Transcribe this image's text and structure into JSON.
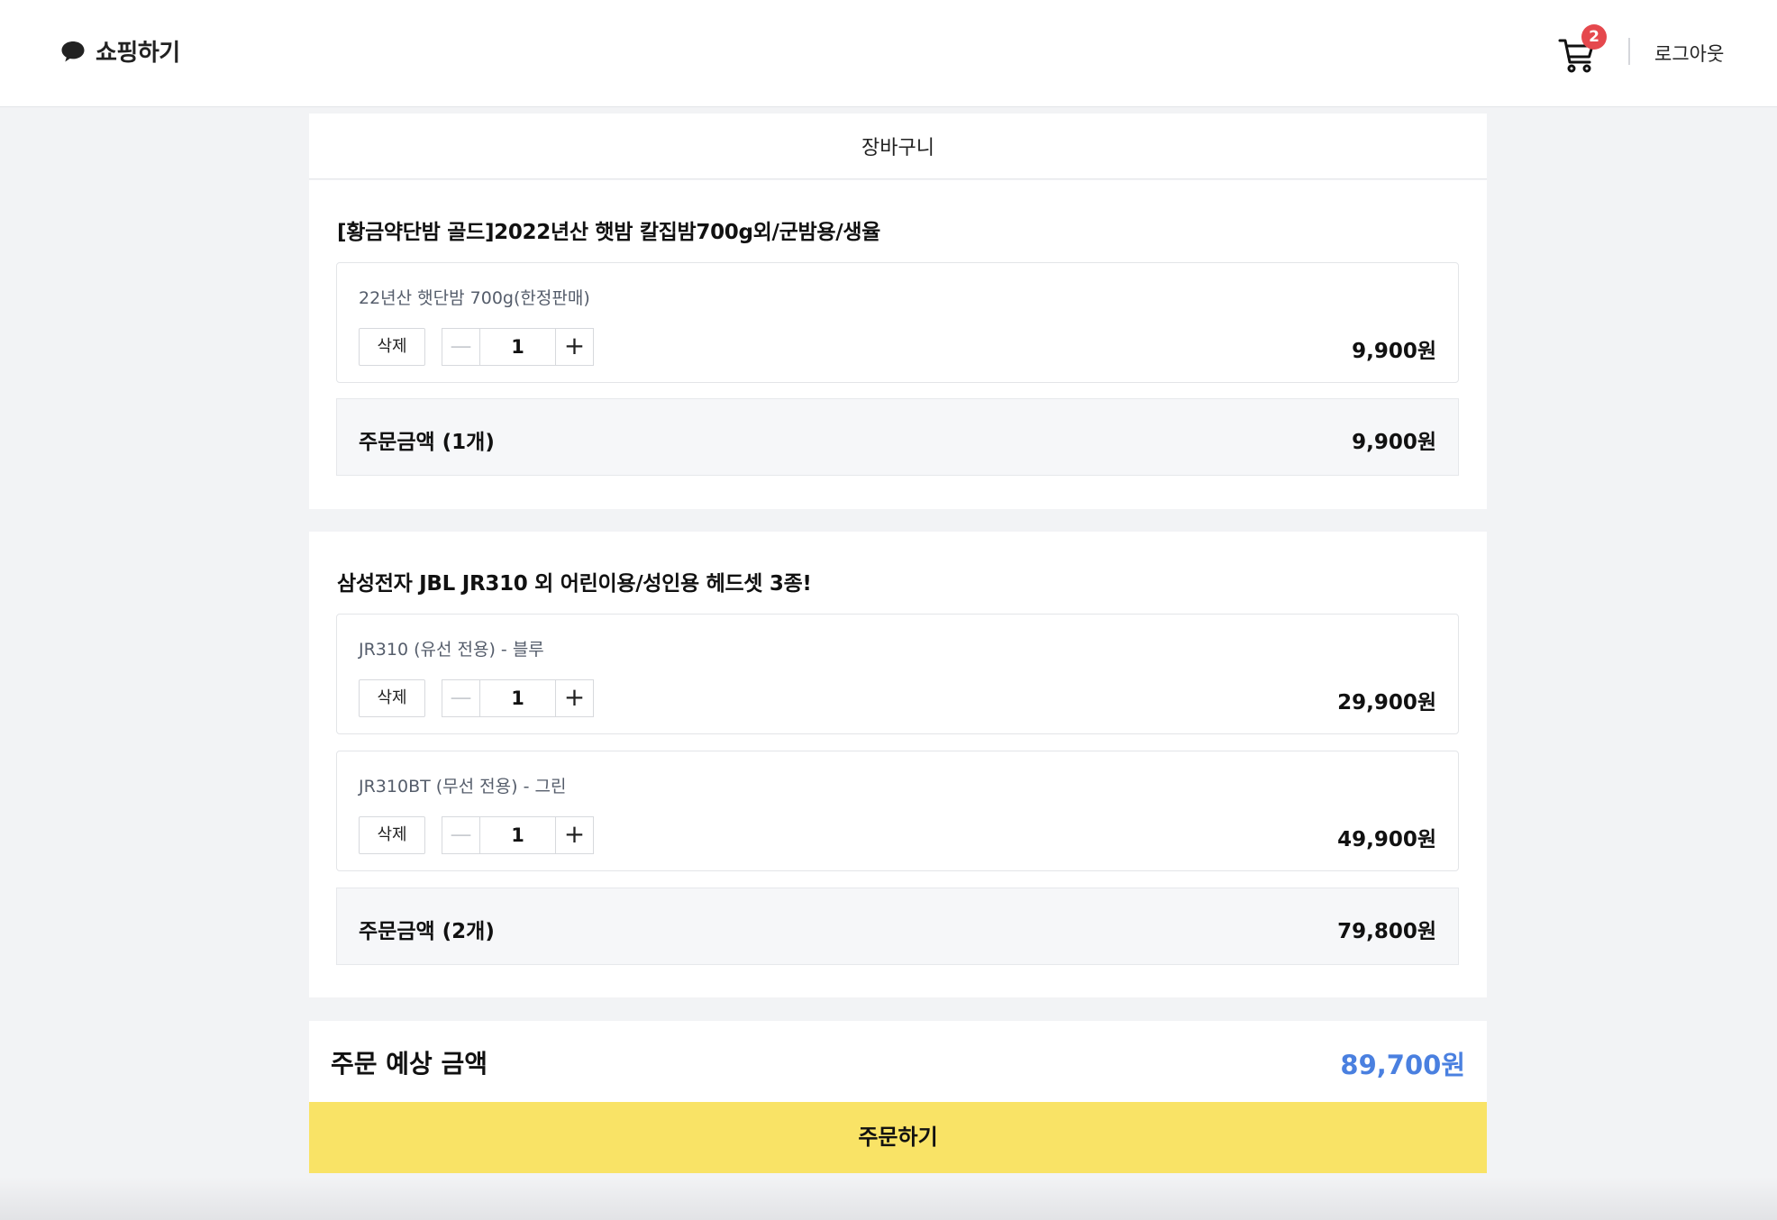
{
  "header": {
    "logo_icon": "speech-bubble-icon",
    "logo_text": "쇼핑하기",
    "cart_icon": "cart-icon",
    "cart_count": "2",
    "logout_label": "로그아웃"
  },
  "cart": {
    "title": "장바구니",
    "groups": [
      {
        "product_title": "[황금약단밤 골드]2022년산 햇밤 칼집밤700g외/군밤용/생율",
        "options": [
          {
            "name": "22년산 햇단밤 700g(한정판매)",
            "delete_label": "삭제",
            "minus": "—",
            "quantity": "1",
            "plus": "+",
            "price": "9,900원"
          }
        ],
        "subtotal_label": "주문금액 (1개)",
        "subtotal_value": "9,900원"
      },
      {
        "product_title": "삼성전자 JBL JR310 외 어린이용/성인용 헤드셋 3종!",
        "options": [
          {
            "name": "JR310 (유선 전용) - 블루",
            "delete_label": "삭제",
            "minus": "—",
            "quantity": "1",
            "plus": "+",
            "price": "29,900원"
          },
          {
            "name": "JR310BT (무선 전용) - 그린",
            "delete_label": "삭제",
            "minus": "—",
            "quantity": "1",
            "plus": "+",
            "price": "49,900원"
          }
        ],
        "subtotal_label": "주문금액 (2개)",
        "subtotal_value": "79,800원"
      }
    ]
  },
  "summary": {
    "label": "주문 예상 금액",
    "value": "89,700원",
    "value_color": "#4a80e0"
  },
  "order_button_label": "주문하기",
  "colors": {
    "accent_yellow": "#f9e366",
    "badge_red": "#e5484d",
    "total_blue": "#4a80e0"
  }
}
